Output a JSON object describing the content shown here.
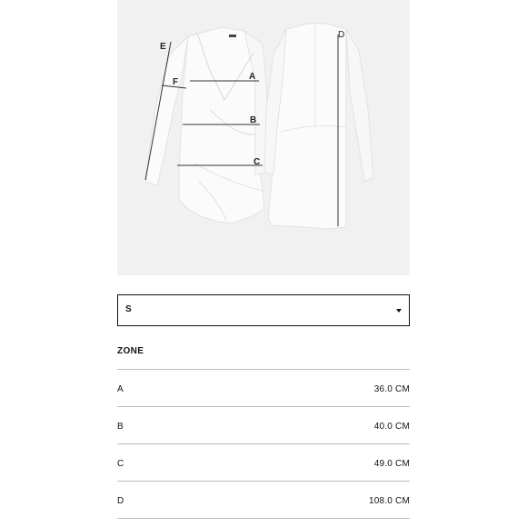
{
  "figure": {
    "markers": {
      "a": "A",
      "b": "B",
      "c": "C",
      "d": "D",
      "e": "E",
      "f": "F"
    }
  },
  "size_select": {
    "selected": "S"
  },
  "table": {
    "title": "ZONE",
    "rows": [
      {
        "zone": "A",
        "value": "36.0 CM"
      },
      {
        "zone": "B",
        "value": "40.0 CM"
      },
      {
        "zone": "C",
        "value": "49.0 CM"
      },
      {
        "zone": "D",
        "value": "108.0 CM"
      }
    ]
  }
}
